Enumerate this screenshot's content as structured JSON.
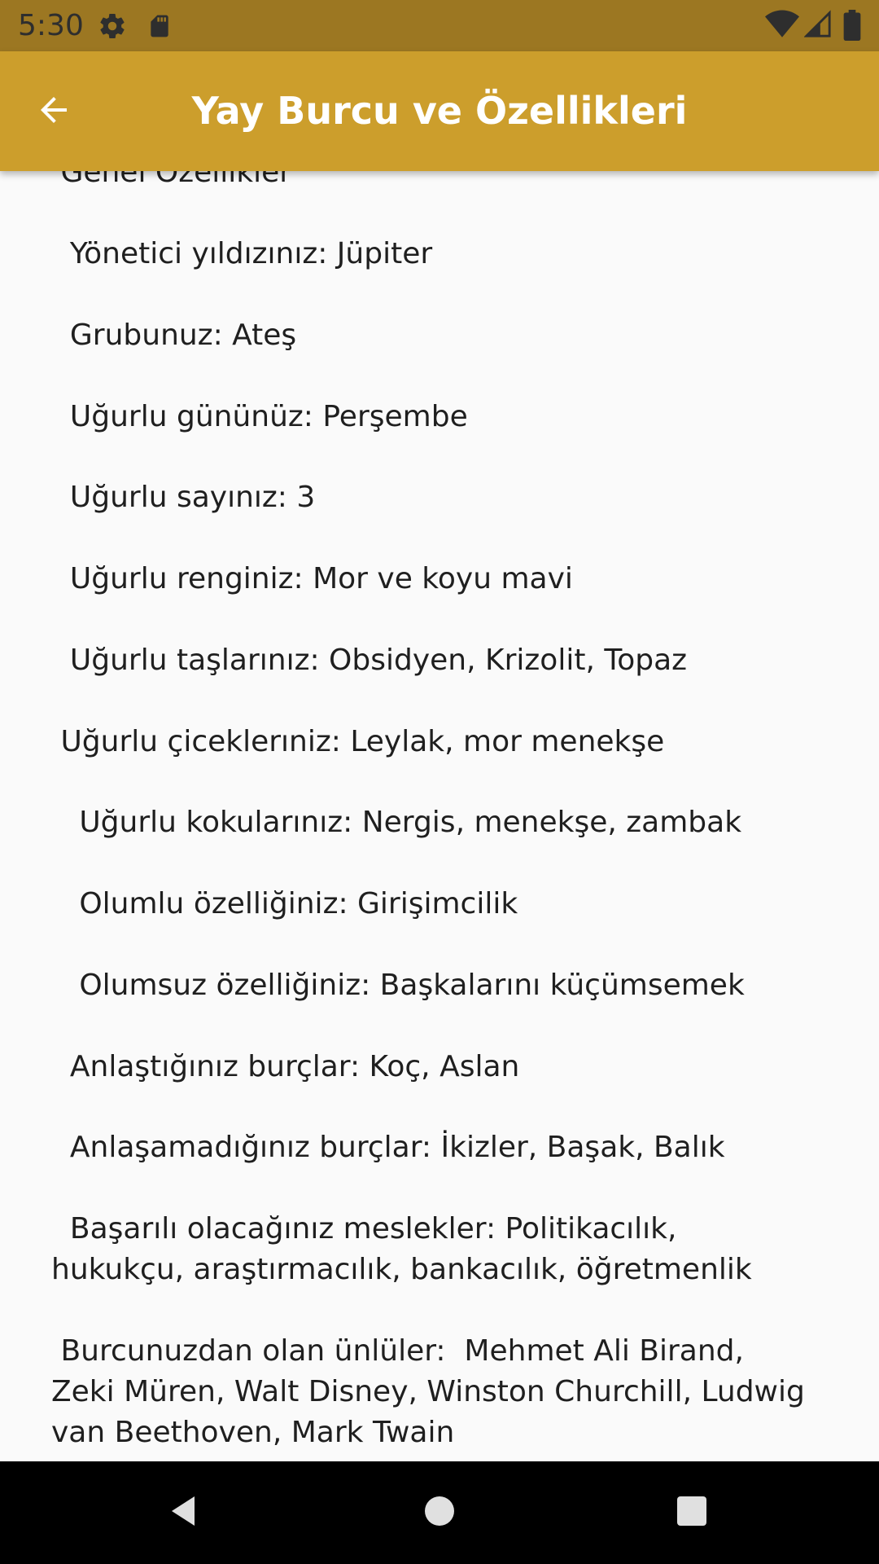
{
  "status_bar": {
    "time": "5:30",
    "icons": [
      "gear-icon",
      "sd-card-icon",
      "wifi-icon",
      "cellular-signal-icon",
      "battery-icon"
    ]
  },
  "app_bar": {
    "title": "Yay Burcu ve Özellikleri",
    "back_icon": "arrow-back-icon"
  },
  "content": {
    "lines": [
      " Genel Ozellikler",
      "  Yönetici yıldızınız: Jüpiter",
      "  Grubunuz: Ateş",
      "  Uğurlu gününüz: Perşembe",
      "  Uğurlu sayınız: 3",
      "  Uğurlu renginiz: Mor ve koyu mavi",
      "  Uğurlu taşlarınız: Obsidyen, Krizolit, Topaz",
      " Uğurlu çiceklerıniz: Leylak, mor menekşe",
      "   Uğurlu kokularınız: Nergis, menekşe, zambak",
      "   Olumlu özelliğiniz: Girişimcilik",
      "   Olumsuz özelliğiniz: Başkalarını küçümsemek",
      "  Anlaştığınız burçlar: Koç, Aslan",
      "  Anlaşamadığınız burçlar: İkizler, Başak, Balık"
    ],
    "careers": "  Başarılı olacağınız meslekler: Politikacılık,\nhukukçu, araştırmacılık, bankacılık, öğretmenlik",
    "famous": " Burcunuzdan olan ünlüler:  Mehmet Ali Birand,\nZeki Müren, Walt Disney, Winston Churchill, Ludwig\nvan Beethoven, Mark Twain"
  },
  "nav_bar": {
    "icons": [
      "back-triangle-icon",
      "home-circle-icon",
      "recents-square-icon"
    ]
  },
  "colors": {
    "status_bar": "#9c7722",
    "app_bar": "#cc9e2c",
    "background": "#fafafa",
    "text": "#1f1f1f"
  }
}
